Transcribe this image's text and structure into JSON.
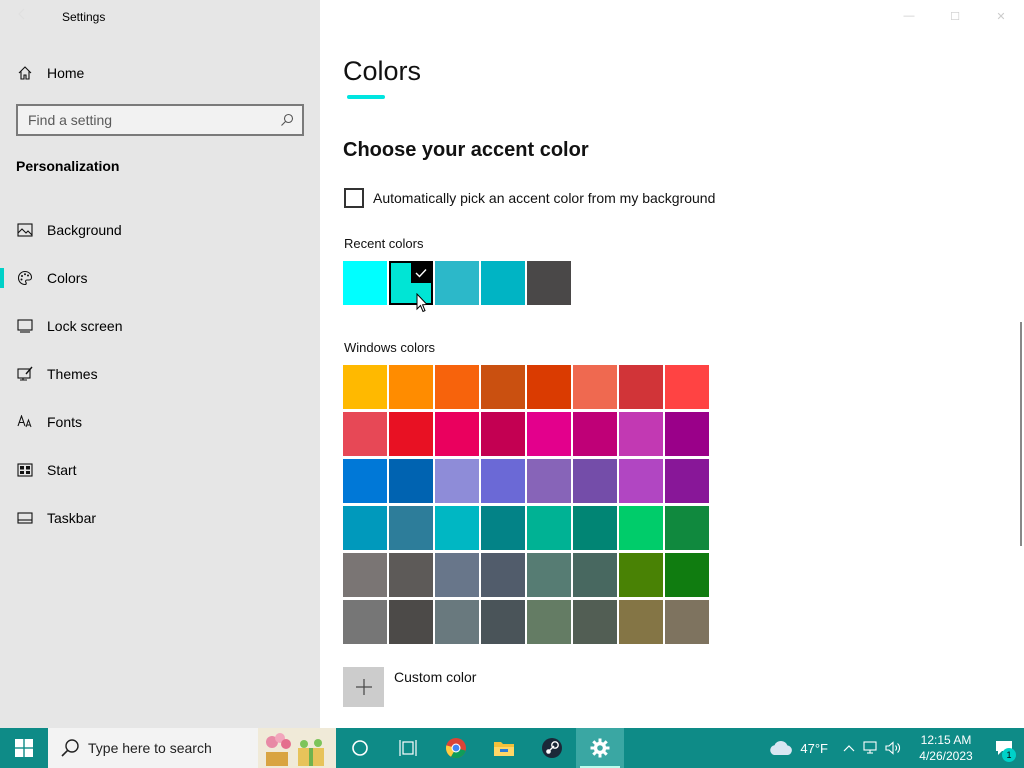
{
  "window": {
    "title": "Settings"
  },
  "sidebar": {
    "home_label": "Home",
    "search_placeholder": "Find a setting",
    "section_title": "Personalization",
    "items": [
      {
        "label": "Background",
        "icon": "image-icon"
      },
      {
        "label": "Colors",
        "icon": "palette-icon",
        "active": true
      },
      {
        "label": "Lock screen",
        "icon": "lock-screen-icon"
      },
      {
        "label": "Themes",
        "icon": "themes-icon"
      },
      {
        "label": "Fonts",
        "icon": "fonts-icon"
      },
      {
        "label": "Start",
        "icon": "start-icon"
      },
      {
        "label": "Taskbar",
        "icon": "taskbar-icon"
      }
    ]
  },
  "main": {
    "title": "Colors",
    "accent_heading": "Choose your accent color",
    "auto_pick_label": "Automatically pick an accent color from my background",
    "auto_pick_checked": false,
    "recent_label": "Recent colors",
    "recent_colors": [
      "#00ffff",
      "#00e5d5",
      "#2cb8c9",
      "#00b4c4",
      "#4a4848"
    ],
    "selected_recent_index": 1,
    "windows_label": "Windows colors",
    "windows_colors": [
      "#ffb900",
      "#ff8c00",
      "#f7630c",
      "#ca5010",
      "#da3b01",
      "#ef6950",
      "#d13438",
      "#ff4343",
      "#e74856",
      "#e81123",
      "#ea005e",
      "#c30052",
      "#e3008c",
      "#bf0077",
      "#c239b3",
      "#9a0089",
      "#0078d7",
      "#0063b1",
      "#8e8cd8",
      "#6b69d6",
      "#8764b8",
      "#744da9",
      "#b146c2",
      "#881798",
      "#0099bc",
      "#2d7d9a",
      "#00b7c3",
      "#038387",
      "#00b294",
      "#018574",
      "#00cc6a",
      "#10893e",
      "#7a7574",
      "#5d5a58",
      "#68768a",
      "#515c6b",
      "#567c73",
      "#486860",
      "#498205",
      "#107c10",
      "#767676",
      "#4c4a48",
      "#69797e",
      "#4a5459",
      "#647c64",
      "#525e54",
      "#847545",
      "#7e735f"
    ],
    "custom_color_label": "Custom color"
  },
  "taskbar": {
    "search_text": "Type here to search",
    "apps": [
      "cortana-icon",
      "task-view-icon",
      "chrome-icon",
      "file-explorer-icon",
      "steam-icon",
      "settings-gear-icon"
    ],
    "active_app": "settings-gear-icon",
    "weather_temp": "47°F",
    "time": "12:15 AM",
    "date": "4/26/2023",
    "notification_count": "1"
  },
  "colors": {
    "taskbar_bg": "#0e8b87",
    "accent": "#00d1c8",
    "sidebar_bg": "#e6e6e6"
  }
}
